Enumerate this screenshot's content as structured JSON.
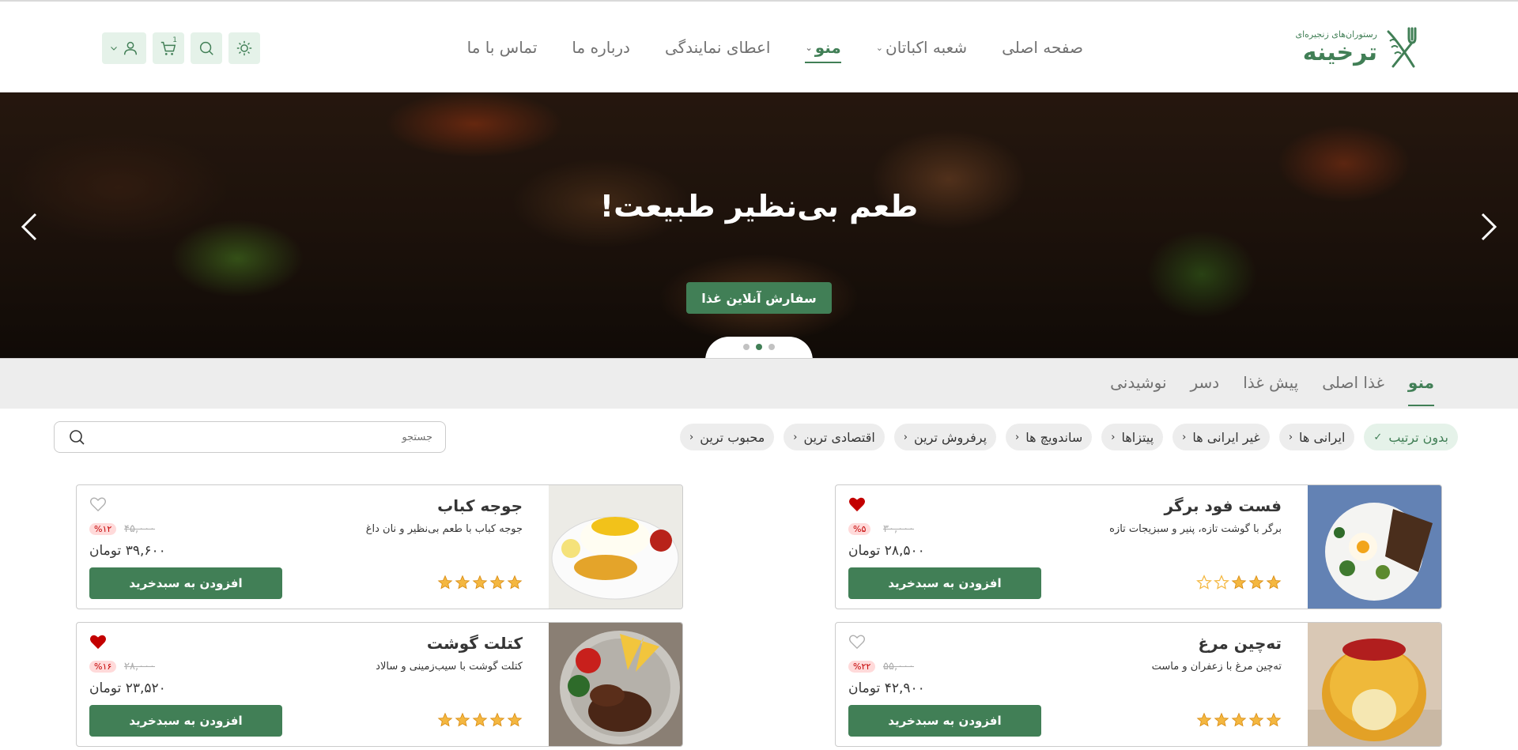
{
  "brand": {
    "small": "رستوران‌های زنجیره‌ای",
    "name": "ترخینه",
    "color": "#417f56"
  },
  "nav": [
    {
      "label": "صفحه اصلی",
      "active": false
    },
    {
      "label": "شعبه اکباتان",
      "active": false,
      "dropdown": true
    },
    {
      "label": "منو",
      "active": true,
      "dropdown": true
    },
    {
      "label": "اعطای نمایندگی",
      "active": false
    },
    {
      "label": "درباره ما",
      "active": false
    },
    {
      "label": "تماس با ما",
      "active": false
    }
  ],
  "tools": {
    "cart_count": "1",
    "icons": [
      "sun-icon",
      "search-icon",
      "cart-icon",
      "user-icon"
    ]
  },
  "hero": {
    "title": "طعم بی‌نظیر طبیعت!",
    "button": "سفارش آنلاین غذا",
    "slides": 3,
    "current_slide": 2
  },
  "category_tabs": [
    {
      "label": "منو",
      "active": true
    },
    {
      "label": "غذا اصلی",
      "active": false
    },
    {
      "label": "پیش غذا",
      "active": false
    },
    {
      "label": "دسر",
      "active": false
    },
    {
      "label": "نوشیدنی",
      "active": false
    }
  ],
  "filters": [
    {
      "label": "بدون ترتیب",
      "active": true,
      "icon": "check-icon"
    },
    {
      "label": "ایرانی ها",
      "active": false,
      "icon": "chevron-left-icon"
    },
    {
      "label": "غیر ایرانی ها",
      "active": false,
      "icon": "chevron-left-icon"
    },
    {
      "label": "پیتزاها",
      "active": false,
      "icon": "chevron-left-icon"
    },
    {
      "label": "ساندویچ ها",
      "active": false,
      "icon": "chevron-left-icon"
    },
    {
      "label": "پرفروش ترین",
      "active": false,
      "icon": "chevron-left-icon"
    },
    {
      "label": "اقتصادی ترین",
      "active": false,
      "icon": "chevron-left-icon"
    },
    {
      "label": "محبوب ترین",
      "active": false,
      "icon": "chevron-left-icon"
    }
  ],
  "search": {
    "placeholder": "جستجو"
  },
  "products": [
    {
      "name": "فست فود برگر",
      "desc": "برگر با گوشت تازه، پنیر و سبزیجات تازه",
      "old_price": "۳۰,۰۰۰",
      "discount": "%۵",
      "price": "۲۸,۵۰۰ تومان",
      "rating": 3,
      "favorite": true,
      "button": "افزودن به سبدخرید"
    },
    {
      "name": "جوجه کباب",
      "desc": "جوجه کباب با طعم بی‌نظیر و نان داغ",
      "old_price": "۴۵,۰۰۰",
      "discount": "%۱۲",
      "price": "۳۹,۶۰۰ تومان",
      "rating": 5,
      "favorite": false,
      "button": "افزودن به سبدخرید"
    },
    {
      "name": "ته‌چین مرغ",
      "desc": "ته‌چین مرغ با زعفران و ماست",
      "old_price": "۵۵,۰۰۰",
      "discount": "%۲۲",
      "price": "۴۲,۹۰۰ تومان",
      "rating": 5,
      "favorite": false,
      "button": "افزودن به سبدخرید"
    },
    {
      "name": "کتلت گوشت",
      "desc": "کتلت گوشت با سیب‌زمینی و سالاد",
      "old_price": "۲۸,۰۰۰",
      "discount": "%۱۶",
      "price": "۲۳,۵۲۰ تومان",
      "rating": 5,
      "favorite": true,
      "button": "افزودن به سبدخرید"
    }
  ]
}
